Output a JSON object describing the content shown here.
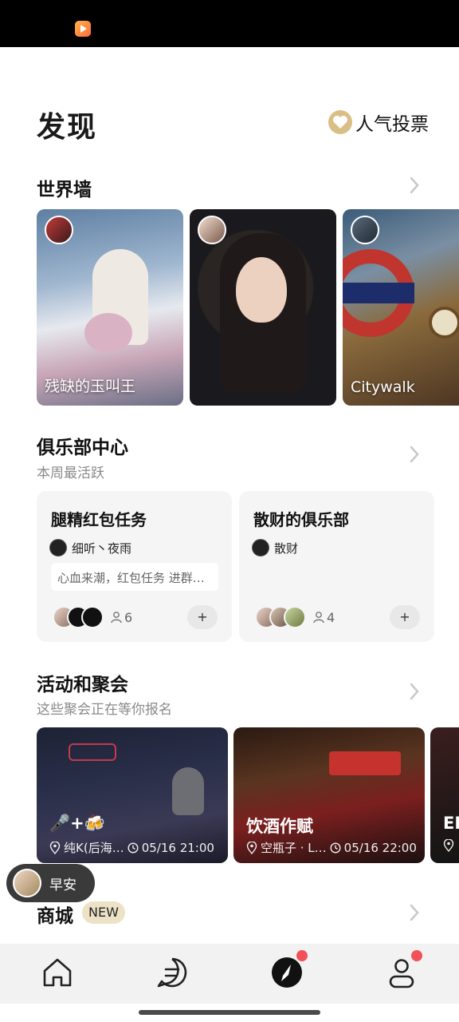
{
  "page": {
    "title": "发现"
  },
  "vote": {
    "label": "人气投票"
  },
  "world_wall": {
    "title": "世界墙",
    "cards": [
      {
        "caption": "残缺的玉叫王"
      },
      {
        "caption": ""
      },
      {
        "caption": "Citywalk"
      }
    ]
  },
  "clubs": {
    "title": "俱乐部中心",
    "subtitle": "本周最活跃",
    "items": [
      {
        "name": "腿精红包任务",
        "owner": "细听丶夜雨",
        "note": "心血来潮，红包任务 进群…",
        "members": "6",
        "add": "+"
      },
      {
        "name": "散财的俱乐部",
        "owner": "散财",
        "note": "",
        "members": "4",
        "add": "+"
      }
    ]
  },
  "events": {
    "title": "活动和聚会",
    "subtitle": "这些聚会正在等你报名",
    "items": [
      {
        "title": "🎤+🍻",
        "place": "纯K(后海…",
        "time": "05/16 21:00"
      },
      {
        "title": "饮酒作赋",
        "place": "空瓶子 · L…",
        "time": "05/16 22:00"
      },
      {
        "title": "ED",
        "place": "",
        "time": ""
      }
    ]
  },
  "shop": {
    "title": "商城",
    "badge": "NEW"
  },
  "greeting": {
    "text": "早安"
  },
  "colors": {
    "accent_gold": "#d9bf86",
    "notify_red": "#f2515a",
    "tab_bg": "#f2f2f2"
  },
  "tabs": [
    {
      "icon": "home-icon"
    },
    {
      "icon": "chat-icon"
    },
    {
      "icon": "compass-icon",
      "active": true,
      "badge": true
    },
    {
      "icon": "profile-icon",
      "badge": true
    }
  ]
}
